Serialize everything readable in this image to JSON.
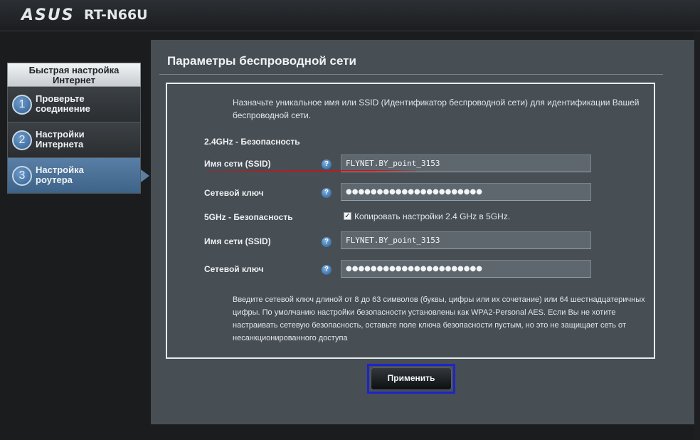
{
  "header": {
    "logo": "ASUS",
    "model": "RT-N66U"
  },
  "sidebar": {
    "title": "Быстрая настройка Интернет",
    "items": [
      {
        "num": "1",
        "label": "Проверьте соединение",
        "active": false
      },
      {
        "num": "2",
        "label": "Настройки Интернета",
        "active": false
      },
      {
        "num": "3",
        "label": "Настройка роутера",
        "active": true
      }
    ]
  },
  "main": {
    "title": "Параметры беспроводной сети",
    "description": "Назначьте уникальное имя или SSID (Идентификатор беспроводной сети) для идентификации Вашей беспроводной сети.",
    "band24": {
      "section_label": "2.4GHz - Безопасность",
      "ssid_label": "Имя сети (SSID)",
      "ssid_value": "FLYNET.BY_point_3153",
      "key_label": "Сетевой ключ",
      "key_value": "●●●●●●●●●●●●●●●●●●●●●●"
    },
    "band5": {
      "section_label": "5GHz - Безопасность",
      "copy_checkbox_label": "Копировать настройки 2.4 GHz в 5GHz.",
      "copy_checked": true,
      "ssid_label": "Имя сети (SSID)",
      "ssid_value": "FLYNET.BY_point_3153",
      "key_label": "Сетевой ключ",
      "key_value": "●●●●●●●●●●●●●●●●●●●●●●"
    },
    "help_icon": "?",
    "note": "Введите сетевой ключ длиной от 8 до 63 символов (буквы, цифры или их сочетание) или 64 шестнадцатеричных цифры. По умолчанию настройки безопасности установлены как WPA2-Personal AES. Если Вы не хотите настраивать сетевую безопасность, оставьте поле ключа безопасности пустым, но это не защищает сеть от несанкционированного доступа",
    "apply_label": "Применить"
  }
}
